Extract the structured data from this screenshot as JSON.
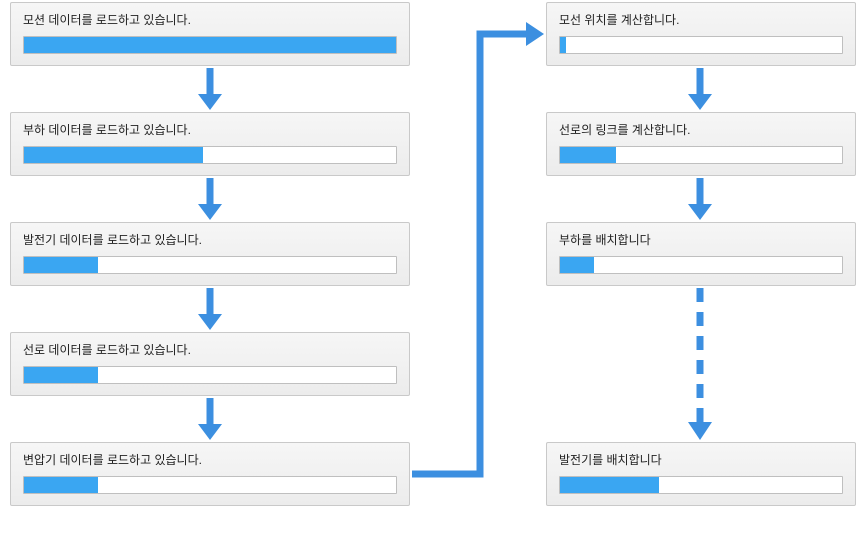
{
  "colors": {
    "arrow": "#3c8fe0",
    "progress": "#3aa6f2",
    "box_bg_top": "#f6f6f6",
    "box_bg_bottom": "#ececec",
    "box_border": "#c9c9c9"
  },
  "left_column": [
    {
      "id": "motion-load",
      "label": "모션 데이터를 로드하고 있습니다.",
      "progress_pct": 100
    },
    {
      "id": "load-load",
      "label": "부하 데이터를 로드하고 있습니다.",
      "progress_pct": 48
    },
    {
      "id": "generator-load",
      "label": "발전기 데이터를 로드하고 있습니다.",
      "progress_pct": 20
    },
    {
      "id": "line-load",
      "label": "선로 데이터를 로드하고 있습니다.",
      "progress_pct": 20
    },
    {
      "id": "transformer-load",
      "label": "변압기 데이터를 로드하고 있습니다.",
      "progress_pct": 20
    }
  ],
  "right_column": [
    {
      "id": "motion-calc",
      "label": "모선 위치를 계산합니다.",
      "progress_pct": 2
    },
    {
      "id": "line-link-calc",
      "label": "선로의 링크를 계산합니다.",
      "progress_pct": 20
    },
    {
      "id": "load-place",
      "label": "부하를 배치합니다",
      "progress_pct": 12
    },
    {
      "id": "generator-place",
      "label": "발전기를 배치합니다",
      "progress_pct": 35
    }
  ],
  "connections": [
    {
      "from": "motion-load",
      "to": "load-load",
      "style": "solid"
    },
    {
      "from": "load-load",
      "to": "generator-load",
      "style": "solid"
    },
    {
      "from": "generator-load",
      "to": "line-load",
      "style": "solid"
    },
    {
      "from": "line-load",
      "to": "transformer-load",
      "style": "solid"
    },
    {
      "from": "transformer-load",
      "to": "motion-calc",
      "style": "solid",
      "path": "right-up-right"
    },
    {
      "from": "motion-calc",
      "to": "line-link-calc",
      "style": "solid"
    },
    {
      "from": "line-link-calc",
      "to": "load-place",
      "style": "solid"
    },
    {
      "from": "load-place",
      "to": "generator-place",
      "style": "dashed"
    }
  ]
}
